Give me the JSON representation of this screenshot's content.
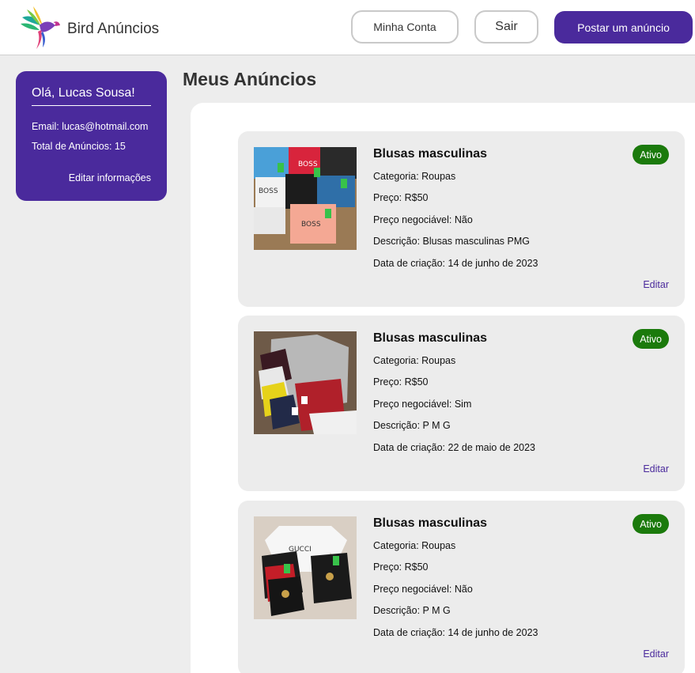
{
  "header": {
    "brand": "Bird Anúncios",
    "account_label": "Minha Conta",
    "logout_label": "Sair",
    "post_label": "Postar um anúncio"
  },
  "profile": {
    "greeting": "Olá, Lucas Sousa!",
    "email": "Email: lucas@hotmail.com",
    "total": "Total de Anúncios: 15",
    "edit_label": "Editar informações"
  },
  "main": {
    "title": "Meus Anúncios"
  },
  "ads": [
    {
      "title": "Blusas masculinas",
      "status": "Ativo",
      "category": "Categoria: Roupas",
      "price": "Preço: R$50",
      "negotiable": "Preço negociável: Não",
      "description": "Descrição: Blusas masculinas PMG",
      "created": "Data de criação: 14 de junho de 2023",
      "edit_label": "Editar"
    },
    {
      "title": "Blusas masculinas",
      "status": "Ativo",
      "category": "Categoria: Roupas",
      "price": "Preço: R$50",
      "negotiable": "Preço negociável: Sim",
      "description": "Descrição: P M G",
      "created": "Data de criação: 22 de maio de 2023",
      "edit_label": "Editar"
    },
    {
      "title": "Blusas masculinas",
      "status": "Ativo",
      "category": "Categoria: Roupas",
      "price": "Preço: R$50",
      "negotiable": "Preço negociável: Não",
      "description": "Descrição: P M G",
      "created": "Data de criação: 14 de junho de 2023",
      "edit_label": "Editar"
    }
  ],
  "colors": {
    "brand_purple": "#4a2a9c",
    "status_green": "#1b7a0c",
    "background": "#ededed"
  }
}
